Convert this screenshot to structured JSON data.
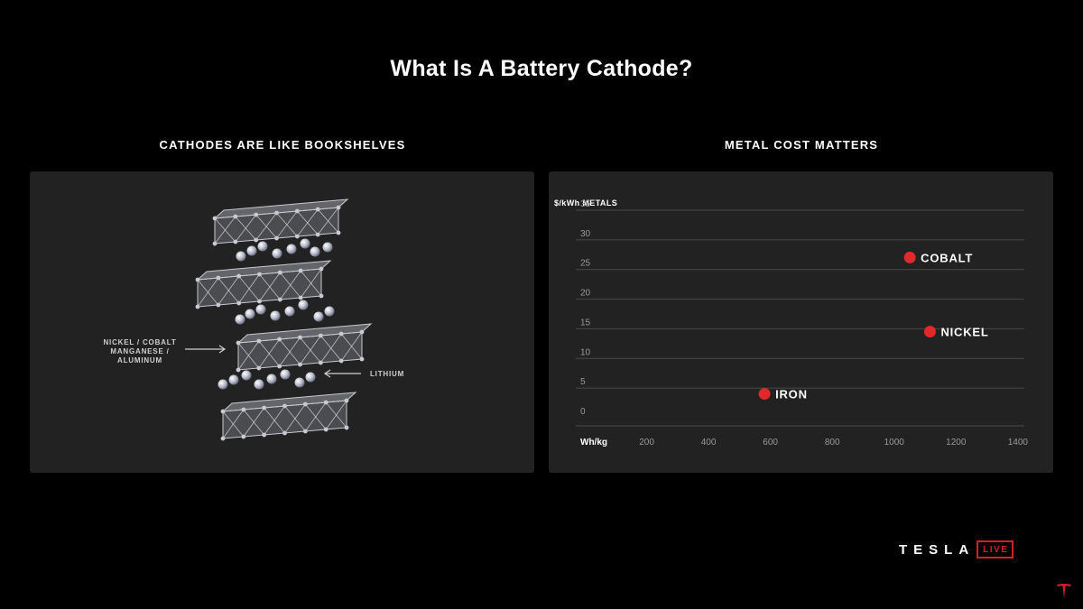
{
  "title": "What Is A Battery Cathode?",
  "left_panel": {
    "heading": "CATHODES ARE LIKE BOOKSHELVES",
    "label_metals": [
      "NICKEL / COBALT",
      "MANGANESE /",
      "ALUMINUM"
    ],
    "label_lithium": "LITHIUM"
  },
  "right_panel": {
    "heading": "METAL COST MATTERS"
  },
  "branding": {
    "wordmark": "TESLA",
    "badge": "LIVE"
  },
  "colors": {
    "background": "#000000",
    "panel": "#222222",
    "accent_red": "#e02a2a",
    "gridline": "#4a4a4a"
  },
  "chart_data": {
    "type": "scatter",
    "title": "METAL COST MATTERS",
    "xlabel": "Wh/kg",
    "ylabel": "$/kWh METALS",
    "xlim": [
      0,
      1450
    ],
    "ylim": [
      0,
      35
    ],
    "x_ticks": [
      200,
      400,
      600,
      800,
      1000,
      1200,
      1400
    ],
    "y_ticks": [
      0,
      5,
      10,
      15,
      20,
      25,
      30,
      35
    ],
    "grid": "horizontal",
    "points": [
      {
        "label": "COBALT",
        "x": 1080,
        "y": 29
      },
      {
        "label": "NICKEL",
        "x": 1145,
        "y": 16.5
      },
      {
        "label": "IRON",
        "x": 610,
        "y": 6
      }
    ]
  }
}
